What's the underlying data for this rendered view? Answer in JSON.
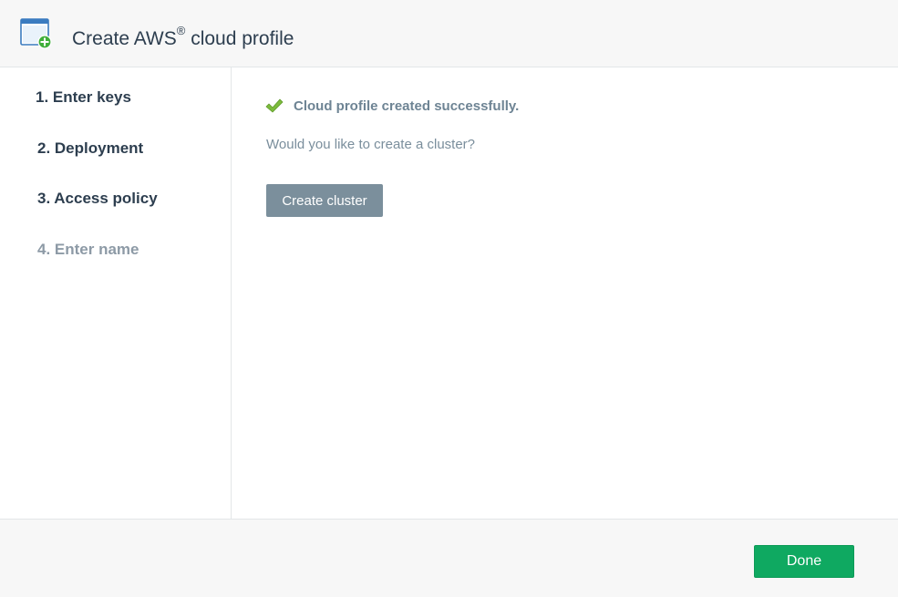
{
  "header": {
    "title": "Create AWS",
    "title_superscript": "®",
    "title_suffix": " cloud profile",
    "icon": "window-add-icon"
  },
  "sidebar": {
    "steps": [
      {
        "label": "1. Enter keys",
        "state": "completed"
      },
      {
        "label": "2. Deployment",
        "state": "completed"
      },
      {
        "label": "3. Access policy",
        "state": "completed"
      },
      {
        "label": "4. Enter name",
        "state": "inactive"
      }
    ]
  },
  "main": {
    "success_icon": "checkmark-icon",
    "success_message": "Cloud profile created successfully.",
    "question": "Would you like to create a cluster?",
    "create_cluster_label": "Create cluster"
  },
  "footer": {
    "done_label": "Done"
  },
  "colors": {
    "accent_green": "#0fa961",
    "check_green": "#7dbb3c",
    "secondary_button": "#7b8f9c",
    "text_dark": "#2d3e4f",
    "text_muted": "#8d9aa6"
  }
}
